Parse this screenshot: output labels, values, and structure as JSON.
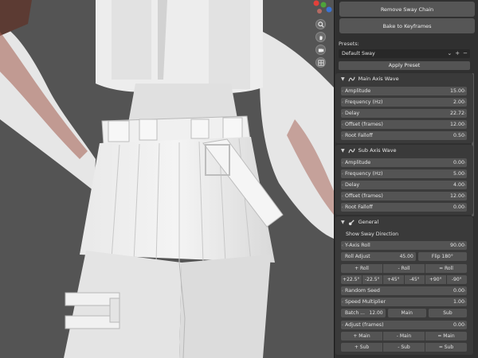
{
  "panel": {
    "remove_button": "Remove Sway Chain",
    "bake_button": "Bake to Keyframes",
    "presets_label": "Presets:",
    "preset_value": "Default Sway",
    "preset_add": "+",
    "preset_remove": "−",
    "apply_button": "Apply Preset"
  },
  "main_wave": {
    "title": "Main Axis Wave",
    "rows": [
      {
        "label": "Amplitude",
        "value": "15.00"
      },
      {
        "label": "Frequency (Hz)",
        "value": "2.00"
      },
      {
        "label": "Delay",
        "value": "22.72"
      },
      {
        "label": "Offset (frames)",
        "value": "12.00"
      },
      {
        "label": "Root Falloff",
        "value": "0.50"
      }
    ]
  },
  "sub_wave": {
    "title": "Sub Axis Wave",
    "rows": [
      {
        "label": "Amplitude",
        "value": "0.00"
      },
      {
        "label": "Frequency (Hz)",
        "value": "5.00"
      },
      {
        "label": "Delay",
        "value": "4.00"
      },
      {
        "label": "Offset (frames)",
        "value": "12.00"
      },
      {
        "label": "Root Falloff",
        "value": "0.00"
      }
    ]
  },
  "general": {
    "title": "General",
    "show_direction": "Show Sway Direction",
    "y_axis_roll": {
      "label": "Y-Axis Roll",
      "value": "90.00"
    },
    "roll_adjust": {
      "label": "Roll Adjust",
      "value": "45.00",
      "flip": "Flip 180°"
    },
    "roll_buttons": [
      "+ Roll",
      "- Roll",
      "= Roll"
    ],
    "angle_buttons": [
      "+22.5°",
      "-22.5°",
      "+45°",
      "-45°",
      "+90°",
      "-90°"
    ],
    "random_seed": {
      "label": "Random Seed",
      "value": "0.00"
    },
    "speed_multiplier": {
      "label": "Speed Multiplier",
      "value": "1.00"
    },
    "batch": {
      "label": "Batch ...",
      "value": "12.00",
      "main": "Main",
      "sub": "Sub"
    },
    "adjust_frames": {
      "label": "Adjust (frames)",
      "value": "0.00"
    },
    "main_buttons": [
      "+ Main",
      "- Main",
      "= Main"
    ],
    "sub_buttons": [
      "+ Sub",
      "- Sub",
      "= Sub"
    ]
  },
  "viewport": {
    "gizmo_colors": {
      "x": "#e4403a",
      "y": "#4ea43a",
      "z": "#3b73d4"
    },
    "icons": [
      "zoom-icon",
      "hand-icon",
      "camera-icon",
      "grid-icon"
    ]
  }
}
